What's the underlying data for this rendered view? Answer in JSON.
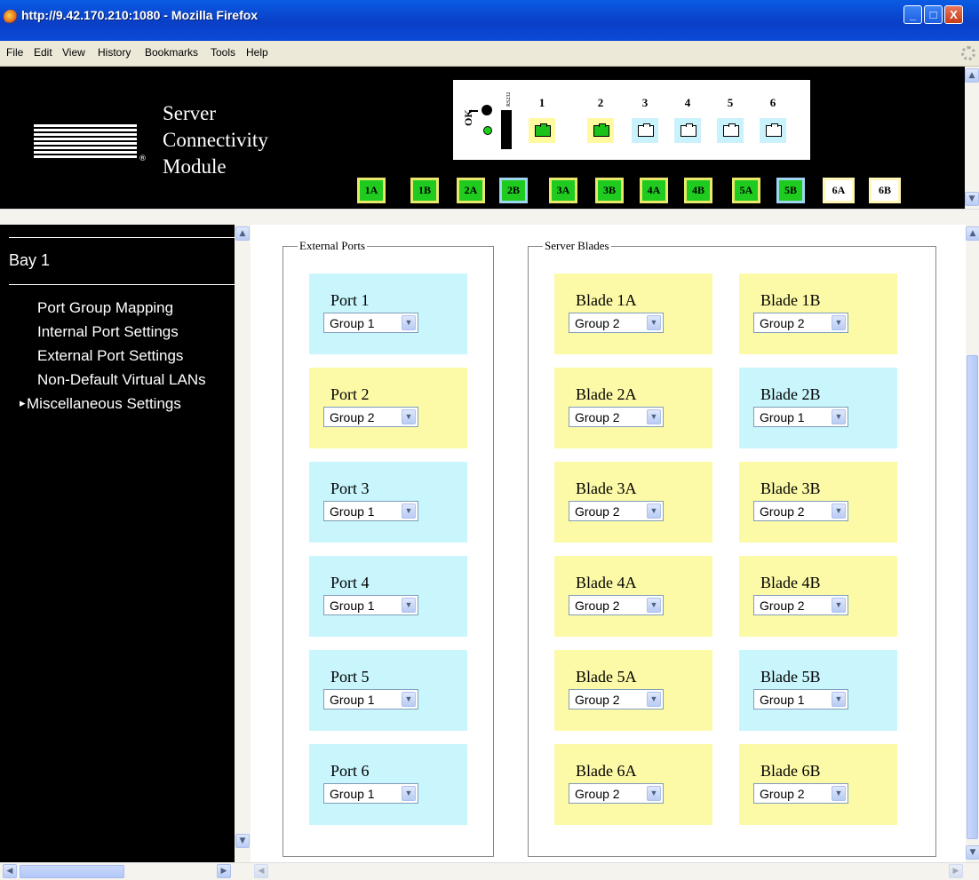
{
  "window": {
    "title": "http://9.42.170.210:1080 - Mozilla Firefox",
    "minimize": "_",
    "maximize": "□",
    "close": "X"
  },
  "menu": [
    "File",
    "Edit",
    "View",
    "History",
    "Bookmarks",
    "Tools",
    "Help"
  ],
  "header": {
    "logo": "IBM",
    "logo_mark": "®",
    "product_lines": [
      "Server",
      "Connectivity",
      "Module"
    ],
    "panel": {
      "rs232_label": "RS232",
      "ok_label": "OK",
      "ok_led_color": "#1ad01a",
      "ports": [
        {
          "num": "1",
          "active": true
        },
        {
          "num": "2",
          "active": true
        },
        {
          "num": "3",
          "active": false
        },
        {
          "num": "4",
          "active": false
        },
        {
          "num": "5",
          "active": false
        },
        {
          "num": "6",
          "active": false
        }
      ]
    },
    "bays": [
      {
        "label": "1A",
        "state": "on"
      },
      {
        "label": "1B",
        "state": "on"
      },
      {
        "label": "2A",
        "state": "on"
      },
      {
        "label": "2B",
        "state": "linked"
      },
      {
        "label": "3A",
        "state": "on"
      },
      {
        "label": "3B",
        "state": "on"
      },
      {
        "label": "4A",
        "state": "on"
      },
      {
        "label": "4B",
        "state": "on"
      },
      {
        "label": "5A",
        "state": "on"
      },
      {
        "label": "5B",
        "state": "linked"
      },
      {
        "label": "6A",
        "state": "off"
      },
      {
        "label": "6B",
        "state": "off"
      }
    ]
  },
  "nav": {
    "bay_title": "Bay 1",
    "items": [
      {
        "label": "Port Group Mapping",
        "current": false
      },
      {
        "label": "Internal Port Settings",
        "current": false
      },
      {
        "label": "External Port Settings",
        "current": false
      },
      {
        "label": "Non-Default Virtual LANs",
        "current": false
      },
      {
        "label": "Miscellaneous Settings",
        "current": true
      }
    ]
  },
  "main": {
    "external": {
      "legend": "External Ports",
      "ports": [
        {
          "label": "Port 1",
          "group": "Group 1",
          "color": "blue"
        },
        {
          "label": "Port 2",
          "group": "Group 2",
          "color": "yellow"
        },
        {
          "label": "Port 3",
          "group": "Group 1",
          "color": "blue"
        },
        {
          "label": "Port 4",
          "group": "Group 1",
          "color": "blue"
        },
        {
          "label": "Port 5",
          "group": "Group 1",
          "color": "blue"
        },
        {
          "label": "Port 6",
          "group": "Group 1",
          "color": "blue"
        }
      ]
    },
    "blades": {
      "legend": "Server Blades",
      "items": [
        {
          "label": "Blade 1A",
          "group": "Group 2",
          "color": "yellow"
        },
        {
          "label": "Blade 1B",
          "group": "Group 2",
          "color": "yellow"
        },
        {
          "label": "Blade 2A",
          "group": "Group 2",
          "color": "yellow"
        },
        {
          "label": "Blade 2B",
          "group": "Group 1",
          "color": "blue"
        },
        {
          "label": "Blade 3A",
          "group": "Group 2",
          "color": "yellow"
        },
        {
          "label": "Blade 3B",
          "group": "Group 2",
          "color": "yellow"
        },
        {
          "label": "Blade 4A",
          "group": "Group 2",
          "color": "yellow"
        },
        {
          "label": "Blade 4B",
          "group": "Group 2",
          "color": "yellow"
        },
        {
          "label": "Blade 5A",
          "group": "Group 2",
          "color": "yellow"
        },
        {
          "label": "Blade 5B",
          "group": "Group 1",
          "color": "blue"
        },
        {
          "label": "Blade 6A",
          "group": "Group 2",
          "color": "yellow"
        },
        {
          "label": "Blade 6B",
          "group": "Group 2",
          "color": "yellow"
        }
      ]
    }
  },
  "colors": {
    "group1_cell": "#c8f6fc",
    "group2_cell": "#fdfaa7",
    "bay_on": "#1ecb1e"
  }
}
